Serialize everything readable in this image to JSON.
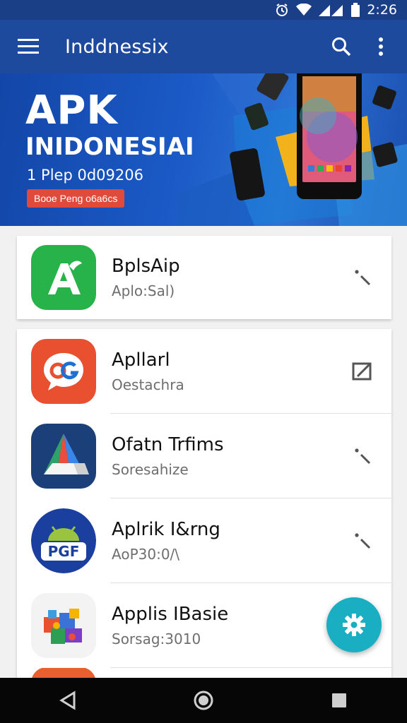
{
  "status": {
    "time": "2:26"
  },
  "app_bar": {
    "title": "Inddnessix"
  },
  "banner": {
    "title": "APK",
    "subtitle": "INIDONESIAI",
    "line": "1 Plep 0d09206",
    "button_label": "Booe Peng o6a6cs"
  },
  "items": [
    {
      "title": "BplsAip",
      "subtitle": "Aplo:Sal)",
      "icon": "android-a-icon",
      "action": "more-icon"
    },
    {
      "title": "Apllarl",
      "subtitle": "Oestachra",
      "icon": "chat-g-icon",
      "action": "open-icon"
    },
    {
      "title": "Ofatn Trfims",
      "subtitle": "Soresahize",
      "icon": "prism-a-icon",
      "action": "more-icon"
    },
    {
      "title": "Aplrik I&rng",
      "subtitle": "AoP30:0/\\",
      "icon": "android-pgf-icon",
      "action": "more-icon"
    },
    {
      "title": "Applis IBasie",
      "subtitle": "Sorsag:3010",
      "icon": "puzzle-icon",
      "action": "none"
    }
  ],
  "colors": {
    "app_bar": "#1e4a9e",
    "fab": "#19aec1",
    "banner_button": "#e04a3b"
  }
}
